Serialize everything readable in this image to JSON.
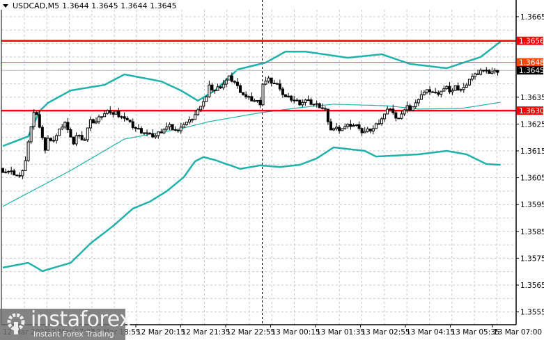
{
  "header": {
    "symbol": "USDCAD,M5",
    "ohlc": "1.3644 1.3645 1.3644 1.3645"
  },
  "logo": {
    "brand": "instaforex",
    "tagline": "Instant Forex Trading"
  },
  "colors": {
    "bull_body": "#ffffff",
    "bear_body": "#000000",
    "band": "#20b2aa",
    "level": "#ff0000",
    "ask_line": "#ff4500",
    "bid_line": "#c0c0c0",
    "grid": "#c8c8c8"
  },
  "chart_data": {
    "type": "candlestick",
    "symbol": "USDCAD",
    "timeframe": "M5",
    "ylim": [
      1.35505,
      1.36695
    ],
    "grid": true,
    "y_ticks": [
      "1.3665",
      "1.3635",
      "1.3625",
      "1.3615",
      "1.3605",
      "1.3595",
      "1.3585",
      "1.3575",
      "1.3565",
      "1.3555"
    ],
    "x_ticks": [
      "12 Mar 2026",
      "12 Mar 17:35",
      "12 Mar 18:55",
      "12 Mar 20:15",
      "12 Mar 21:35",
      "12 Mar 22:55",
      "13 Mar 00:15",
      "13 Mar 01:35",
      "13 Mar 02:55",
      "13 Mar 04:15",
      "13 Mar 05:35",
      "13 Mar 07:00"
    ],
    "bar_count": 176,
    "close_path": [
      [
        0,
        1.36077
      ],
      [
        4,
        1.36065
      ],
      [
        6,
        1.36052
      ],
      [
        8,
        1.36116
      ],
      [
        9,
        1.36181
      ],
      [
        10,
        1.36233
      ],
      [
        11,
        1.36298
      ],
      [
        12,
        1.36285
      ],
      [
        13,
        1.36233
      ],
      [
        14,
        1.36207
      ],
      [
        15,
        1.36155
      ],
      [
        16,
        1.36194
      ],
      [
        17,
        1.36181
      ],
      [
        19,
        1.36207
      ],
      [
        21,
        1.36246
      ],
      [
        22,
        1.36259
      ],
      [
        24,
        1.36194
      ],
      [
        25,
        1.36181
      ],
      [
        26,
        1.36207
      ],
      [
        29,
        1.36194
      ],
      [
        30,
        1.36233
      ],
      [
        31,
        1.36259
      ],
      [
        33,
        1.36259
      ],
      [
        35,
        1.36285
      ],
      [
        37,
        1.36298
      ],
      [
        38,
        1.36285
      ],
      [
        40,
        1.36298
      ],
      [
        41,
        1.36272
      ],
      [
        42,
        1.36285
      ],
      [
        45,
        1.36251
      ],
      [
        47,
        1.36233
      ],
      [
        50,
        1.3622
      ],
      [
        52,
        1.36207
      ],
      [
        54,
        1.36207
      ],
      [
        57,
        1.36233
      ],
      [
        59,
        1.36241
      ],
      [
        62,
        1.3622
      ],
      [
        63,
        1.36246
      ],
      [
        66,
        1.36259
      ],
      [
        68,
        1.36285
      ],
      [
        69,
        1.36298
      ],
      [
        70,
        1.36324
      ],
      [
        72,
        1.36349
      ],
      [
        73,
        1.36388
      ],
      [
        75,
        1.36375
      ],
      [
        78,
        1.36401
      ],
      [
        80,
        1.36422
      ],
      [
        82,
        1.36406
      ],
      [
        83,
        1.36388
      ],
      [
        84,
        1.36375
      ],
      [
        86,
        1.36349
      ],
      [
        89,
        1.36337
      ],
      [
        91,
        1.36329
      ],
      [
        92,
        1.36401
      ],
      [
        94,
        1.36414
      ],
      [
        96,
        1.36401
      ],
      [
        98,
        1.36388
      ],
      [
        99,
        1.36362
      ],
      [
        100,
        1.36349
      ],
      [
        102,
        1.36344
      ],
      [
        105,
        1.36329
      ],
      [
        107,
        1.36337
      ],
      [
        110,
        1.36324
      ],
      [
        112,
        1.36318
      ],
      [
        114,
        1.36303
      ],
      [
        115,
        1.36251
      ],
      [
        116,
        1.36233
      ],
      [
        119,
        1.36233
      ],
      [
        121,
        1.36238
      ],
      [
        123,
        1.36246
      ],
      [
        126,
        1.36241
      ],
      [
        127,
        1.3622
      ],
      [
        128,
        1.3622
      ],
      [
        131,
        1.36233
      ],
      [
        133,
        1.36259
      ],
      [
        136,
        1.36298
      ],
      [
        137,
        1.36311
      ],
      [
        138,
        1.36292
      ],
      [
        139,
        1.36267
      ],
      [
        141,
        1.3629
      ],
      [
        143,
        1.36311
      ],
      [
        144,
        1.36306
      ],
      [
        146,
        1.36324
      ],
      [
        147,
        1.36349
      ],
      [
        148,
        1.36362
      ],
      [
        151,
        1.36375
      ],
      [
        153,
        1.36362
      ],
      [
        155,
        1.36375
      ],
      [
        157,
        1.36383
      ],
      [
        158,
        1.36375
      ],
      [
        159,
        1.36375
      ],
      [
        160,
        1.36388
      ],
      [
        162,
        1.36381
      ],
      [
        164,
        1.36388
      ],
      [
        165,
        1.36422
      ],
      [
        167,
        1.36432
      ],
      [
        169,
        1.36453
      ],
      [
        170,
        1.36448
      ],
      [
        171,
        1.36443
      ],
      [
        174,
        1.36445
      ],
      [
        175,
        1.3645
      ]
    ],
    "bollinger_upper": [
      [
        0,
        1.36168
      ],
      [
        9,
        1.36204
      ],
      [
        13,
        1.36298
      ],
      [
        16,
        1.36329
      ],
      [
        24,
        1.36375
      ],
      [
        36,
        1.36396
      ],
      [
        43,
        1.36435
      ],
      [
        56,
        1.36409
      ],
      [
        63,
        1.36375
      ],
      [
        69,
        1.36337
      ],
      [
        75,
        1.36375
      ],
      [
        83,
        1.36453
      ],
      [
        93,
        1.36479
      ],
      [
        100,
        1.3652
      ],
      [
        107,
        1.3652
      ],
      [
        122,
        1.36497
      ],
      [
        134,
        1.3651
      ],
      [
        144,
        1.36474
      ],
      [
        157,
        1.36458
      ],
      [
        169,
        1.365
      ],
      [
        176,
        1.36557
      ]
    ],
    "bollinger_middle": [
      [
        0,
        1.35943
      ],
      [
        24,
        1.36077
      ],
      [
        43,
        1.36194
      ],
      [
        63,
        1.36233
      ],
      [
        73,
        1.36259
      ],
      [
        91,
        1.36292
      ],
      [
        105,
        1.36311
      ],
      [
        117,
        1.36324
      ],
      [
        136,
        1.36318
      ],
      [
        147,
        1.36306
      ],
      [
        162,
        1.36308
      ],
      [
        176,
        1.36331
      ]
    ],
    "bollinger_lower": [
      [
        0,
        1.35715
      ],
      [
        9,
        1.35733
      ],
      [
        14,
        1.35702
      ],
      [
        24,
        1.35733
      ],
      [
        31,
        1.35805
      ],
      [
        39,
        1.3587
      ],
      [
        46,
        1.35935
      ],
      [
        52,
        1.35961
      ],
      [
        58,
        1.36
      ],
      [
        64,
        1.36052
      ],
      [
        68,
        1.36111
      ],
      [
        71,
        1.36127
      ],
      [
        75,
        1.36116
      ],
      [
        84,
        1.36083
      ],
      [
        91,
        1.36096
      ],
      [
        98,
        1.3609
      ],
      [
        105,
        1.36098
      ],
      [
        111,
        1.36122
      ],
      [
        117,
        1.36163
      ],
      [
        128,
        1.3615
      ],
      [
        132,
        1.36129
      ],
      [
        147,
        1.36137
      ],
      [
        157,
        1.3615
      ],
      [
        164,
        1.36137
      ],
      [
        171,
        1.36101
      ],
      [
        176,
        1.36098
      ]
    ],
    "levels": [
      {
        "price": 1.3656,
        "label": "1.3656",
        "kind": "resistance"
      },
      {
        "price": 1.363,
        "label": "1.3630",
        "kind": "support"
      }
    ],
    "ask": {
      "price": 1.3648,
      "label": "1.3648"
    },
    "bid": {
      "price": 1.3645,
      "label": "1.3645"
    },
    "day_separator_bar": 92
  }
}
